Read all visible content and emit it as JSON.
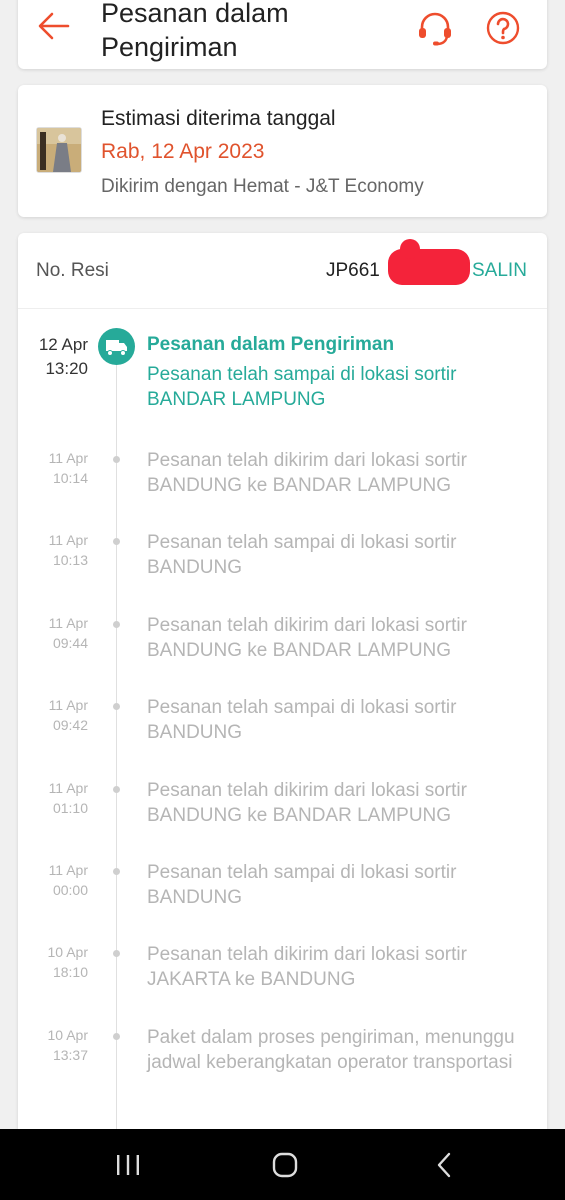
{
  "header": {
    "title": "Pesanan dalam Pengiriman",
    "back_icon": "arrow-left-icon",
    "support_icon": "headset-icon",
    "help_icon": "question-circle-icon"
  },
  "estimate": {
    "title": "Estimasi diterima tanggal",
    "date": "Rab, 12 Apr 2023",
    "courier": "Dikirim dengan Hemat - J&T Economy"
  },
  "tracking": {
    "resi_label": "No. Resi",
    "resi_value": "JP661",
    "copy_label": "SALIN",
    "current": {
      "date": "12 Apr",
      "time": "13:20",
      "title": "Pesanan dalam Pengiriman",
      "text": "Pesanan telah sampai di lokasi sortir BANDAR LAMPUNG"
    },
    "events": [
      {
        "date": "11 Apr",
        "time": "10:14",
        "text": "Pesanan telah dikirim dari lokasi sortir BANDUNG ke BANDAR LAMPUNG"
      },
      {
        "date": "11 Apr",
        "time": "10:13",
        "text": "Pesanan telah sampai di lokasi sortir BANDUNG"
      },
      {
        "date": "11 Apr",
        "time": "09:44",
        "text": "Pesanan telah dikirim dari lokasi sortir BANDUNG ke BANDAR LAMPUNG"
      },
      {
        "date": "11 Apr",
        "time": "09:42",
        "text": "Pesanan telah sampai di lokasi sortir BANDUNG"
      },
      {
        "date": "11 Apr",
        "time": "01:10",
        "text": "Pesanan telah dikirim dari lokasi sortir BANDUNG ke BANDAR LAMPUNG"
      },
      {
        "date": "11 Apr",
        "time": "00:00",
        "text": "Pesanan telah sampai di lokasi sortir BANDUNG"
      },
      {
        "date": "10 Apr",
        "time": "18:10",
        "text": "Pesanan telah dikirim dari lokasi sortir JAKARTA ke BANDUNG"
      },
      {
        "date": "10 Apr",
        "time": "13:37",
        "text": "Paket dalam proses pengiriman, menunggu jadwal keberangkatan operator transportasi"
      }
    ]
  },
  "colors": {
    "accent": "#ee4d2d",
    "date_orange": "#e0532d",
    "teal": "#26aa99",
    "muted": "#b5b5b5"
  }
}
